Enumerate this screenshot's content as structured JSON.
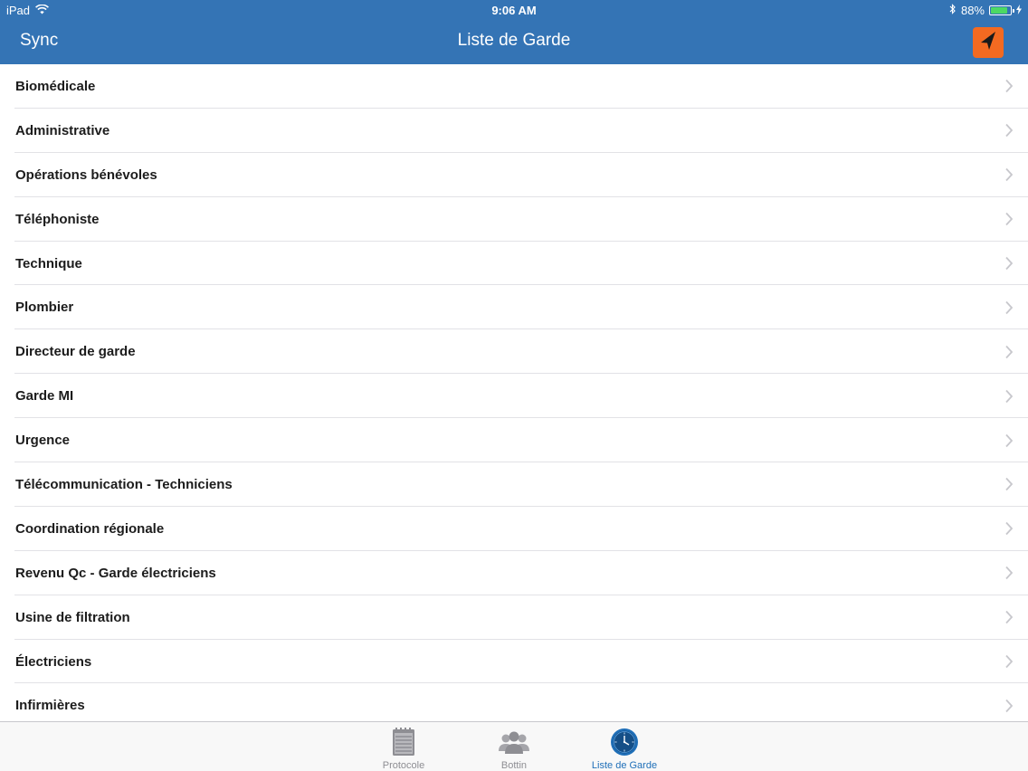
{
  "status_bar": {
    "device": "iPad",
    "time": "9:06 AM",
    "battery_percent": "88%",
    "battery_level": 0.88,
    "icons": [
      "wifi-icon",
      "bluetooth-icon",
      "battery-icon",
      "charging-icon"
    ]
  },
  "nav": {
    "left_button": "Sync",
    "title": "Liste de Garde",
    "right_button_icon": "location-arrow-icon",
    "right_button_color": "#f36a21"
  },
  "colors": {
    "nav_background": "#3474b5",
    "tab_active": "#1f6fb8",
    "tab_inactive": "#8e8e93"
  },
  "list": {
    "items": [
      {
        "label": "Biomédicale"
      },
      {
        "label": "Administrative"
      },
      {
        "label": "Opérations bénévoles"
      },
      {
        "label": "Téléphoniste"
      },
      {
        "label": "Technique"
      },
      {
        "label": "Plombier"
      },
      {
        "label": "Directeur de garde"
      },
      {
        "label": "Garde MI"
      },
      {
        "label": "Urgence"
      },
      {
        "label": "Télécommunication - Techniciens"
      },
      {
        "label": "Coordination régionale"
      },
      {
        "label": "Revenu Qc - Garde électriciens"
      },
      {
        "label": "Usine de filtration"
      },
      {
        "label": "Électriciens"
      },
      {
        "label": "Infirmières"
      }
    ]
  },
  "tabbar": {
    "tabs": [
      {
        "label": "Protocole",
        "icon": "notepad-icon",
        "active": false
      },
      {
        "label": "Bottin",
        "icon": "contacts-icon",
        "active": false
      },
      {
        "label": "Liste de Garde",
        "icon": "clock-icon",
        "active": true
      }
    ]
  }
}
